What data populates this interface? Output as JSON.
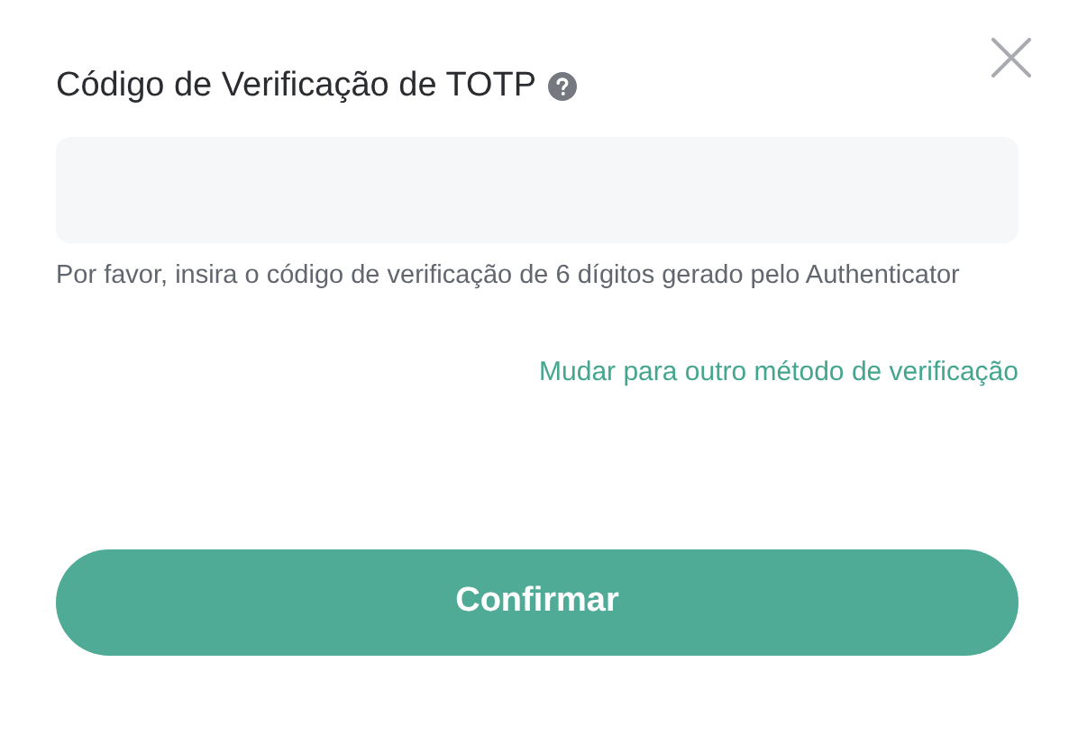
{
  "dialog": {
    "title": "Código de Verificação de TOTP",
    "hint": "Por favor, insira o código de verificação de 6 dígitos gerado pelo Authenticator",
    "switch_link": "Mudar para outro método de verificação",
    "confirm_button": "Confirmar"
  }
}
